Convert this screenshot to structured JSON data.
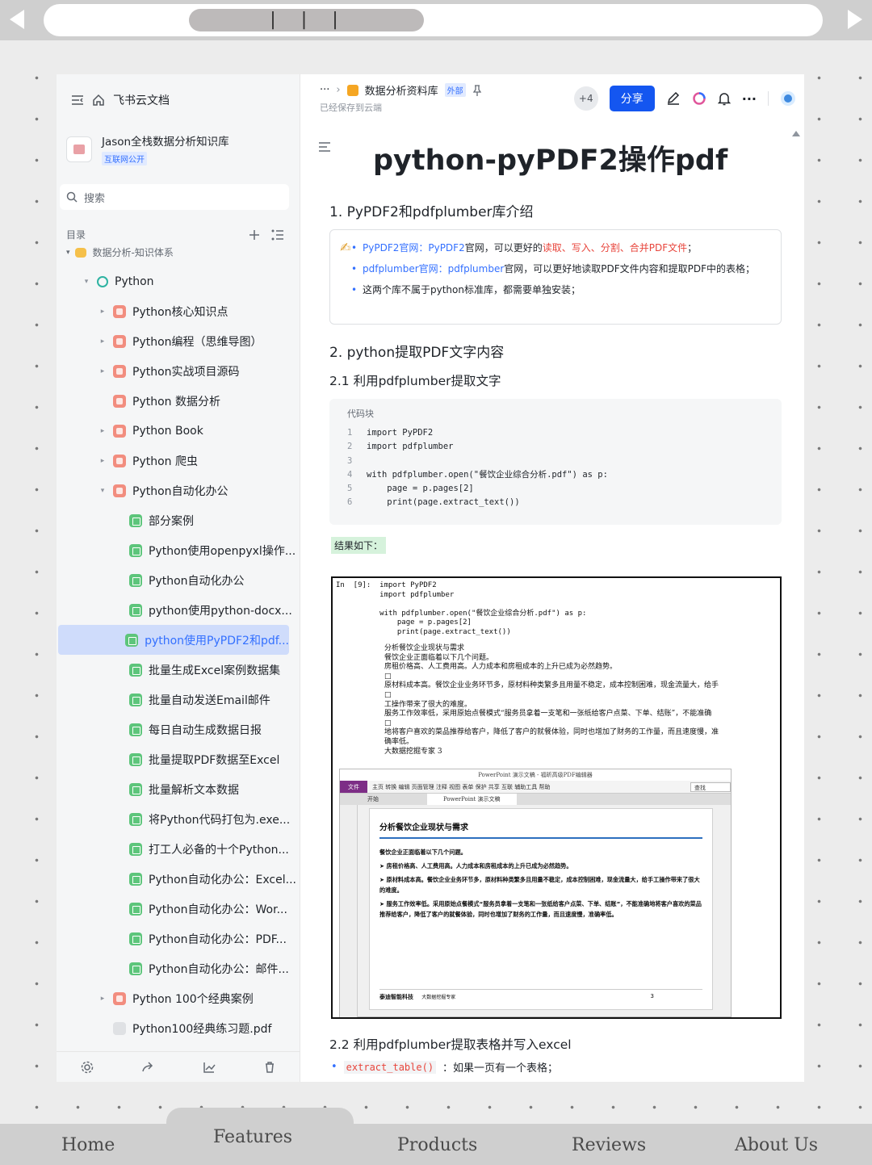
{
  "browser": {
    "handle_label": "| | |"
  },
  "sidebar": {
    "app_name": "飞书云文档",
    "kb_title": "Jason全栈数据分析知识库",
    "kb_badge": "互联网公开",
    "search_placeholder": "搜索",
    "toc_label": "目录",
    "toc_root": "数据分析-知识体系",
    "items": [
      {
        "label": "Python",
        "level": 1,
        "icon": "teal",
        "caret": "▾"
      },
      {
        "label": "Python核心知识点",
        "level": 2,
        "icon": "red",
        "caret": "▸"
      },
      {
        "label": "Python编程（思维导图）",
        "level": 2,
        "icon": "red",
        "caret": "▸"
      },
      {
        "label": "Python实战项目源码",
        "level": 2,
        "icon": "red",
        "caret": "▸"
      },
      {
        "label": "Python 数据分析",
        "level": 2,
        "icon": "red",
        "caret": ""
      },
      {
        "label": "Python Book",
        "level": 2,
        "icon": "red",
        "caret": "▸"
      },
      {
        "label": "Python 爬虫",
        "level": 2,
        "icon": "red",
        "caret": "▸"
      },
      {
        "label": "Python自动化办公",
        "level": 2,
        "icon": "red",
        "caret": "▾"
      },
      {
        "label": "部分案例",
        "level": 3,
        "icon": "green",
        "caret": ""
      },
      {
        "label": "Python使用openpyxl操作...",
        "level": 3,
        "icon": "green",
        "caret": ""
      },
      {
        "label": "Python自动化办公",
        "level": 3,
        "icon": "green",
        "caret": ""
      },
      {
        "label": "python使用python-docx...",
        "level": 3,
        "icon": "green",
        "caret": ""
      },
      {
        "label": "python使用PyPDF2和pdf...",
        "level": 3,
        "icon": "green",
        "caret": "",
        "active": true
      },
      {
        "label": "批量生成Excel案例数据集",
        "level": 3,
        "icon": "green",
        "caret": ""
      },
      {
        "label": "批量自动发送Email邮件",
        "level": 3,
        "icon": "green",
        "caret": ""
      },
      {
        "label": "每日自动生成数据日报",
        "level": 3,
        "icon": "green",
        "caret": ""
      },
      {
        "label": "批量提取PDF数据至Excel",
        "level": 3,
        "icon": "green",
        "caret": ""
      },
      {
        "label": "批量解析文本数据",
        "level": 3,
        "icon": "green",
        "caret": ""
      },
      {
        "label": "将Python代码打包为.exe...",
        "level": 3,
        "icon": "green",
        "caret": ""
      },
      {
        "label": "打工人必备的十个Python...",
        "level": 3,
        "icon": "green",
        "caret": ""
      },
      {
        "label": "Python自动化办公：Excel...",
        "level": 3,
        "icon": "green",
        "caret": ""
      },
      {
        "label": "Python自动化办公：Wor...",
        "level": 3,
        "icon": "green",
        "caret": ""
      },
      {
        "label": "Python自动化办公：PDF...",
        "level": 3,
        "icon": "green",
        "caret": ""
      },
      {
        "label": "Python自动化办公：邮件...",
        "level": 3,
        "icon": "green",
        "caret": ""
      },
      {
        "label": "Python 100个经典案例",
        "level": 2,
        "icon": "red",
        "caret": "▸"
      },
      {
        "label": "Python100经典练习题.pdf",
        "level": 2,
        "icon": "gray",
        "caret": ""
      }
    ]
  },
  "header": {
    "ellipsis": "···",
    "breadcrumb": "数据分析资料库",
    "external_badge": "外部",
    "saved_status": "已经保存到云端",
    "collaborators": "+4",
    "share_label": "分享",
    "more": "···"
  },
  "doc": {
    "title": "python-pyPDF2操作pdf",
    "h1": "1. PyPDF2和pdfplumber库介绍",
    "callout": {
      "b1_link1": "PyPDF2官网：",
      "b1_link2": "PyPDF2",
      "b1_text": "官网，可以更好的",
      "b1_red": "读取、写入、分割、合并PDF文件",
      "b1_end": "；",
      "b2_link1": "pdfplumber官网：",
      "b2_link2": "pdfplumber",
      "b2_text": "官网，可以更好地读取PDF文件内容和提取PDF中的表格；",
      "b3_text": "这两个库不属于python标准库，都需要单独安装；"
    },
    "h2": "2. python提取PDF文字内容",
    "h2_1": "2.1 利用pdfplumber提取文字",
    "code_label": "代码块",
    "result_label": "结果如下：",
    "h2_2": "2.2 利用pdfplumber提取表格并写入excel",
    "bullet_code": "extract_table()",
    "bullet_text": "：如果一页有一个表格；"
  },
  "code": {
    "lines": [
      {
        "n": "1",
        "text": "import PyPDF2"
      },
      {
        "n": "2",
        "text": "import pdfplumber"
      },
      {
        "n": "3",
        "text": ""
      },
      {
        "n": "4",
        "text": "with pdfplumber.open(\"餐饮企业综合分析.pdf\") as p:"
      },
      {
        "n": "5",
        "text": "    page = p.pages[2]"
      },
      {
        "n": "6",
        "text": "    print(page.extract_text())"
      }
    ]
  },
  "screenshot": {
    "nb_code": "In  [9]:  import PyPDF2\n          import pdfplumber\n\n          with pdfplumber.open(\"餐饮企业综合分析.pdf\") as p:\n              page = p.pages[2]\n              print(page.extract_text())",
    "nb_output": [
      "分析餐饮企业现状与需求",
      "餐饮企业正面临着以下几个问题。",
      "房租价格高、人工费用高。人力成本和房租成本的上升已成为必然趋势。",
      "□",
      "原材料成本高。餐饮企业业务环节多，原材料种类繁多且用量不稳定，成本控制困难，现金流量大，给手",
      "□",
      "工操作带来了很大的难度。",
      "服务工作效率低，采用原始点餐模式“服务员拿着一支笔和一张纸给客户点菜、下单、结账”，不能准确",
      "□",
      "地将客户喜欢的菜品推荐给客户，降低了客户的就餐体验，同时也增加了财务的工作量，而且速度慢，准",
      "确率低。",
      "大数据挖掘专家  3"
    ],
    "pdf_title": "PowerPoint 演示文稿 - 福昕高级PDF编辑器",
    "pdf_file_tab": "文件",
    "pdf_menu": "主页  转换  编辑  页面管理  注释  视图  表单  保护  共享  互联  辅助工具  帮助",
    "pdf_search": "查找",
    "pdf_tab1": "开始",
    "pdf_tab2": "PowerPoint 演示文稿",
    "page_heading": "分析餐饮企业现状与需求",
    "page_lines": [
      "餐饮企业正面临着以下几个问题。",
      "➤  房租价格高、人工费用高。人力成本和房租成本的上升已成为必然趋势。",
      "➤  原材料成本高。餐饮企业业务环节多，原材料种类繁多且用量不稳定，成本控制困难，现金流量大，给手工操作带来了很大的难度。",
      "➤  服务工作效率低。采用原始点餐模式“服务员拿着一支笔和一张纸给客户点菜、下单、结账”，不能准确地将客户喜欢的菜品推荐给客户，降低了客户的就餐体验，同时也增加了财务的工作量，而且速度慢，准确率低。"
    ],
    "page_footer": "泰迪智能科技",
    "page_footer_sub": "大数据挖掘专家",
    "page_number": "3"
  },
  "nav": {
    "home": "Home",
    "features": "Features",
    "products": "Products",
    "reviews": "Reviews",
    "about": "About Us"
  }
}
